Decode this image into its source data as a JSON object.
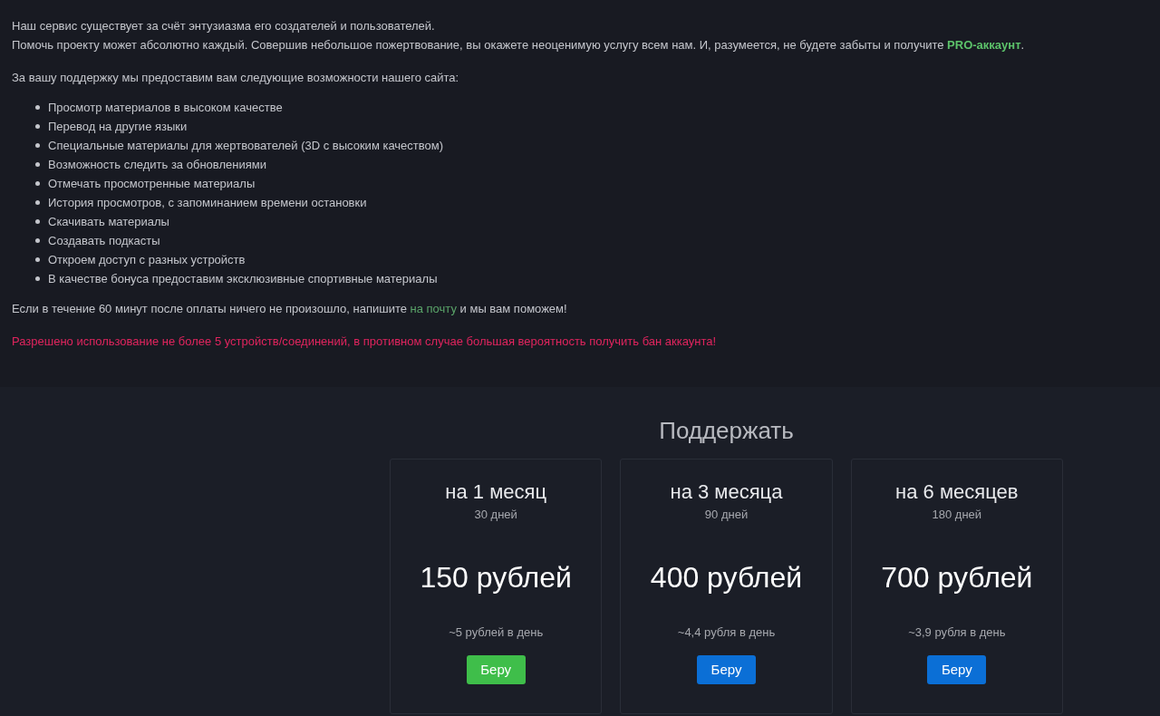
{
  "intro": [
    "Наш сервис существует за счёт энтузиазма его создателей и пользователей.",
    "Помочь проекту может абсолютно каждый. Совершив небольшое пожертвование, вы окажете неоценимую услугу всем нам. И, разумеется, не будете забыты и получите **PRO-аккаунт**."
  ],
  "features_lead": "За вашу поддержку мы предоставим вам следующие возможности нашего сайта:",
  "features": [
    "Просмотр материалов в высоком качестве",
    "Перевод на другие языки",
    "Специальные материалы для жертвователей (3D с высоким качеством)",
    "Возможность следить за обновлениями",
    "Отмечать просмотренные материалы",
    "История просмотров, с запоминанием времени остановки",
    "Скачивать материалы",
    "Создавать подкасты",
    "Откроем доступ с разных устройств",
    "В качестве бонуса предоставим эксклюзивные спортивные материалы"
  ],
  "help_note": {
    "before": "Если в течение 60 минут после оплаты ничего не произошло, напишите",
    "link": "на почту",
    "after": "и мы вам поможем!"
  },
  "warning": "Разрешено использование не более 5 устройств/соединений, в противном случае большая вероятность получить бан аккаунта!",
  "support": {
    "title": "Поддержать",
    "plans": [
      {
        "period": "на 1 месяц",
        "days": "30 дней",
        "price": "150 рублей",
        "per_day": "~5 рублей в день",
        "button": "Беру",
        "color": "#3fbe4a"
      },
      {
        "period": "на 3 месяца",
        "days": "90 дней",
        "price": "400 рублей",
        "per_day": "~4,4 рубля в день",
        "button": "Беру",
        "color": "#0b6fd6"
      },
      {
        "period": "на 6 месяцев",
        "days": "180 дней",
        "price": "700 рублей",
        "per_day": "~3,9 рубля в день",
        "button": "Беру",
        "color": "#0b6fd6"
      }
    ]
  }
}
